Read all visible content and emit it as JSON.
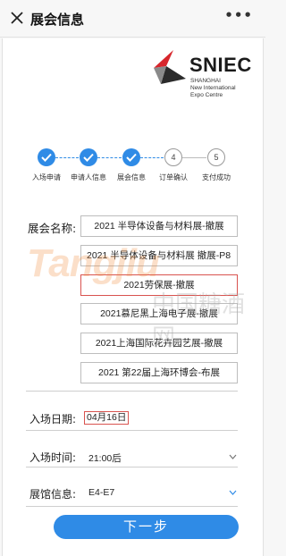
{
  "header": {
    "title": "展会信息",
    "more": "•••"
  },
  "logo": {
    "name": "SNIEC",
    "sub_lines": [
      "SHANGHAI",
      "New International",
      "Expo Centre"
    ]
  },
  "steps": [
    {
      "label": "入场申请",
      "number": "1",
      "done": true
    },
    {
      "label": "申请人信息",
      "number": "2",
      "done": true
    },
    {
      "label": "展会信息",
      "number": "3",
      "done": true
    },
    {
      "label": "订单确认",
      "number": "4",
      "done": false
    },
    {
      "label": "支付成功",
      "number": "5",
      "done": false
    }
  ],
  "exhibition": {
    "label": "展会名称:",
    "items": [
      "2021 半导体设备与材料展-撤展",
      "2021 半导体设备与材料展 撤展-P8",
      "2021劳保展-撤展",
      "2021慕尼黑上海电子展-撤展",
      "2021上海国际花卉园艺展-撤展",
      "2021 第22届上海环博会-布展"
    ],
    "selected_index": 2
  },
  "watermark": {
    "text": "Tangjiu",
    "cn": "中国糖酒网"
  },
  "form": {
    "date_label": "入场日期:",
    "date_value": "04月16日",
    "time_label": "入场时间:",
    "time_value": "21:00后",
    "hall_label": "展馆信息:",
    "hall_value": "E4-E7"
  },
  "next_button": "下一步",
  "colors": {
    "accent": "#2f8be6",
    "selected_border": "#d9534f",
    "logo_red": "#d7262c"
  }
}
